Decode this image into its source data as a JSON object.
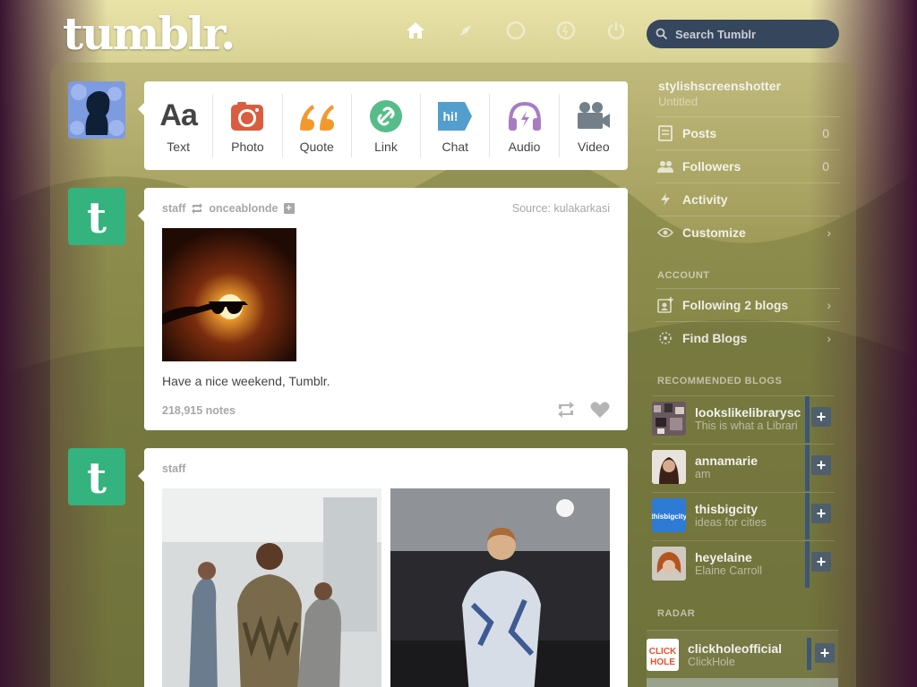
{
  "header": {
    "logo": "tumblr.",
    "nav_icons": [
      "home-icon",
      "compass-icon",
      "mail-icon",
      "lightning-icon",
      "power-icon"
    ],
    "search_placeholder": "Search Tumblr"
  },
  "composer": {
    "items": [
      {
        "label": "Text",
        "icon": "text-icon"
      },
      {
        "label": "Photo",
        "icon": "camera-icon"
      },
      {
        "label": "Quote",
        "icon": "quote-icon"
      },
      {
        "label": "Link",
        "icon": "link-icon"
      },
      {
        "label": "Chat",
        "icon": "chat-icon"
      },
      {
        "label": "Audio",
        "icon": "headphones-icon"
      },
      {
        "label": "Video",
        "icon": "video-camera-icon"
      }
    ]
  },
  "posts": [
    {
      "author": "staff",
      "reblogged_from": "onceablonde",
      "source_label": "Source:",
      "source": "kulakarkasi",
      "caption": "Have a nice weekend, Tumblr.",
      "notes": "218,915 notes"
    },
    {
      "author": "staff"
    }
  ],
  "sidebar": {
    "blog_name": "stylishscreenshotter",
    "blog_title": "Untitled",
    "blog_items": [
      {
        "label": "Posts",
        "count": "0",
        "icon": "posts-icon"
      },
      {
        "label": "Followers",
        "count": "0",
        "icon": "followers-icon"
      },
      {
        "label": "Activity",
        "icon": "activity-icon"
      },
      {
        "label": "Customize",
        "icon": "eye-icon"
      }
    ],
    "account_header": "ACCOUNT",
    "account_items": [
      {
        "label": "Following 2 blogs",
        "icon": "following-icon"
      },
      {
        "label": "Find Blogs",
        "icon": "find-blogs-icon"
      }
    ],
    "recommended_header": "RECOMMENDED BLOGS",
    "recommended": [
      {
        "name": "lookslikelibrarysc",
        "title": "This is what a Librari"
      },
      {
        "name": "annamarie",
        "title": "am"
      },
      {
        "name": "thisbigcity",
        "title": "ideas for cities"
      },
      {
        "name": "heyelaine",
        "title": "Elaine Carroll"
      }
    ],
    "radar_header": "RADAR",
    "radar": {
      "name": "clickholeofficial",
      "title": "ClickHole"
    }
  },
  "colors": {
    "search_bg": "#36465d",
    "tumblr_green": "#35b37e",
    "photo_red": "#d95e40",
    "quote_orange": "#f2992e",
    "link_green": "#56bc8a",
    "chat_blue": "#529ecc",
    "audio_purple": "#a77dc2",
    "video_gray": "#748089"
  }
}
